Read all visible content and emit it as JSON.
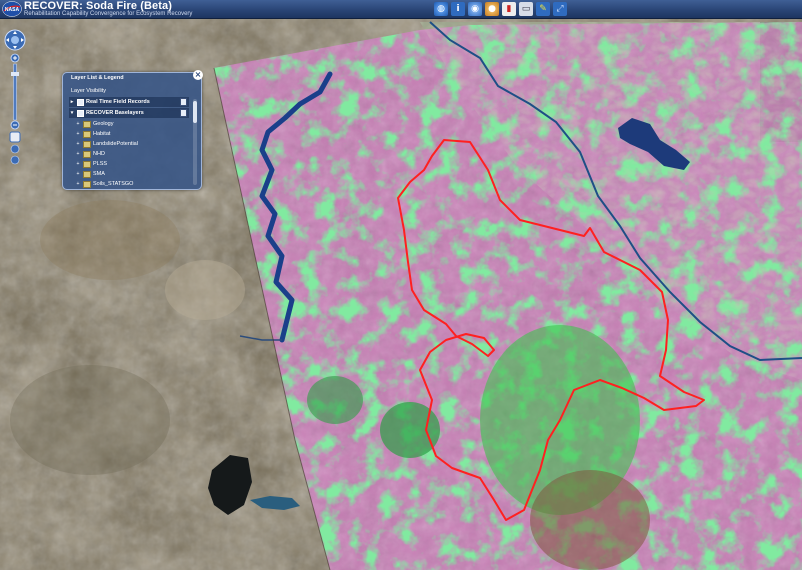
{
  "header": {
    "logo_text": "NASA",
    "title": "RECOVER: Soda Fire (Beta)",
    "subtitle": "Rehabilitation Capability Convergence for Ecosystem Recovery"
  },
  "toolbar": {
    "items": [
      {
        "icon": "globe-icon",
        "color": "#3c7fd6"
      },
      {
        "icon": "info-icon",
        "color": "#2f6bbf"
      },
      {
        "icon": "map-icon",
        "color": "#5b8fd8"
      },
      {
        "icon": "layers-icon",
        "color": "#d8a030"
      },
      {
        "icon": "bookmark-icon",
        "color": "#d44"
      },
      {
        "icon": "print-icon",
        "color": "#c0c8d8"
      },
      {
        "icon": "identify-icon",
        "color": "#c8d040"
      },
      {
        "icon": "measure-icon",
        "color": "#8fb0e0"
      }
    ]
  },
  "map": {
    "fire_perimeter_color": "#ff2020",
    "vegetation_overlay_color": "#e07bd0",
    "green_index_color": "#3fd05a",
    "water_color": "#1a3a7a"
  },
  "legend": {
    "title": "Layer List & Legend",
    "close_label": "×",
    "visibility_label": "Layer Visibility",
    "groups": [
      {
        "label": "Real Time Field Records",
        "expanded": false
      },
      {
        "label": "RECOVER Baselayers",
        "expanded": true
      }
    ],
    "layers": [
      "Geology",
      "Habitat",
      "LandslidePotential",
      "NHD",
      "PLSS",
      "SMA",
      "Soils_STATSGO"
    ]
  }
}
